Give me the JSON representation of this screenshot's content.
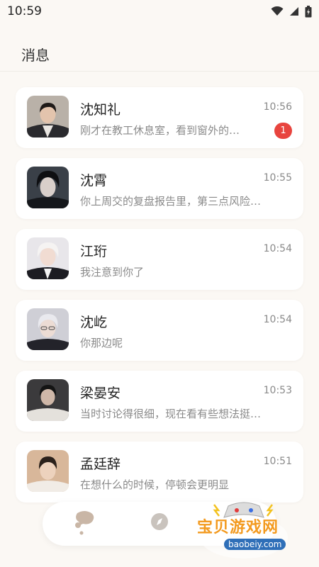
{
  "status_bar": {
    "time": "10:59"
  },
  "header": {
    "title": "消息"
  },
  "messages": [
    {
      "name": "沈知礼",
      "time": "10:56",
      "preview": "刚才在教工休息室，看到窗外的…",
      "unread": "1"
    },
    {
      "name": "沈霄",
      "time": "10:55",
      "preview": "你上周交的复盘报告里，第三点风险…"
    },
    {
      "name": "江珩",
      "time": "10:54",
      "preview": "我注意到你了"
    },
    {
      "name": "沈屹",
      "time": "10:54",
      "preview": "你那边呢"
    },
    {
      "name": "梁晏安",
      "time": "10:53",
      "preview": "当时讨论得很细，现在看有些想法挺…"
    },
    {
      "name": "孟廷辞",
      "time": "10:51",
      "preview": "在想什么的时候，停顿会更明显"
    }
  ],
  "tab_bar": {
    "tabs": [
      "chat-bubble-icon",
      "compass-icon"
    ],
    "active": "chat-bubble-icon"
  },
  "watermark": {
    "text": "宝贝游戏网",
    "url": "baobeiy.com"
  },
  "colors": {
    "background": "#fbf8f4",
    "badge": "#e8443e",
    "watermark": "#f39a1f"
  }
}
